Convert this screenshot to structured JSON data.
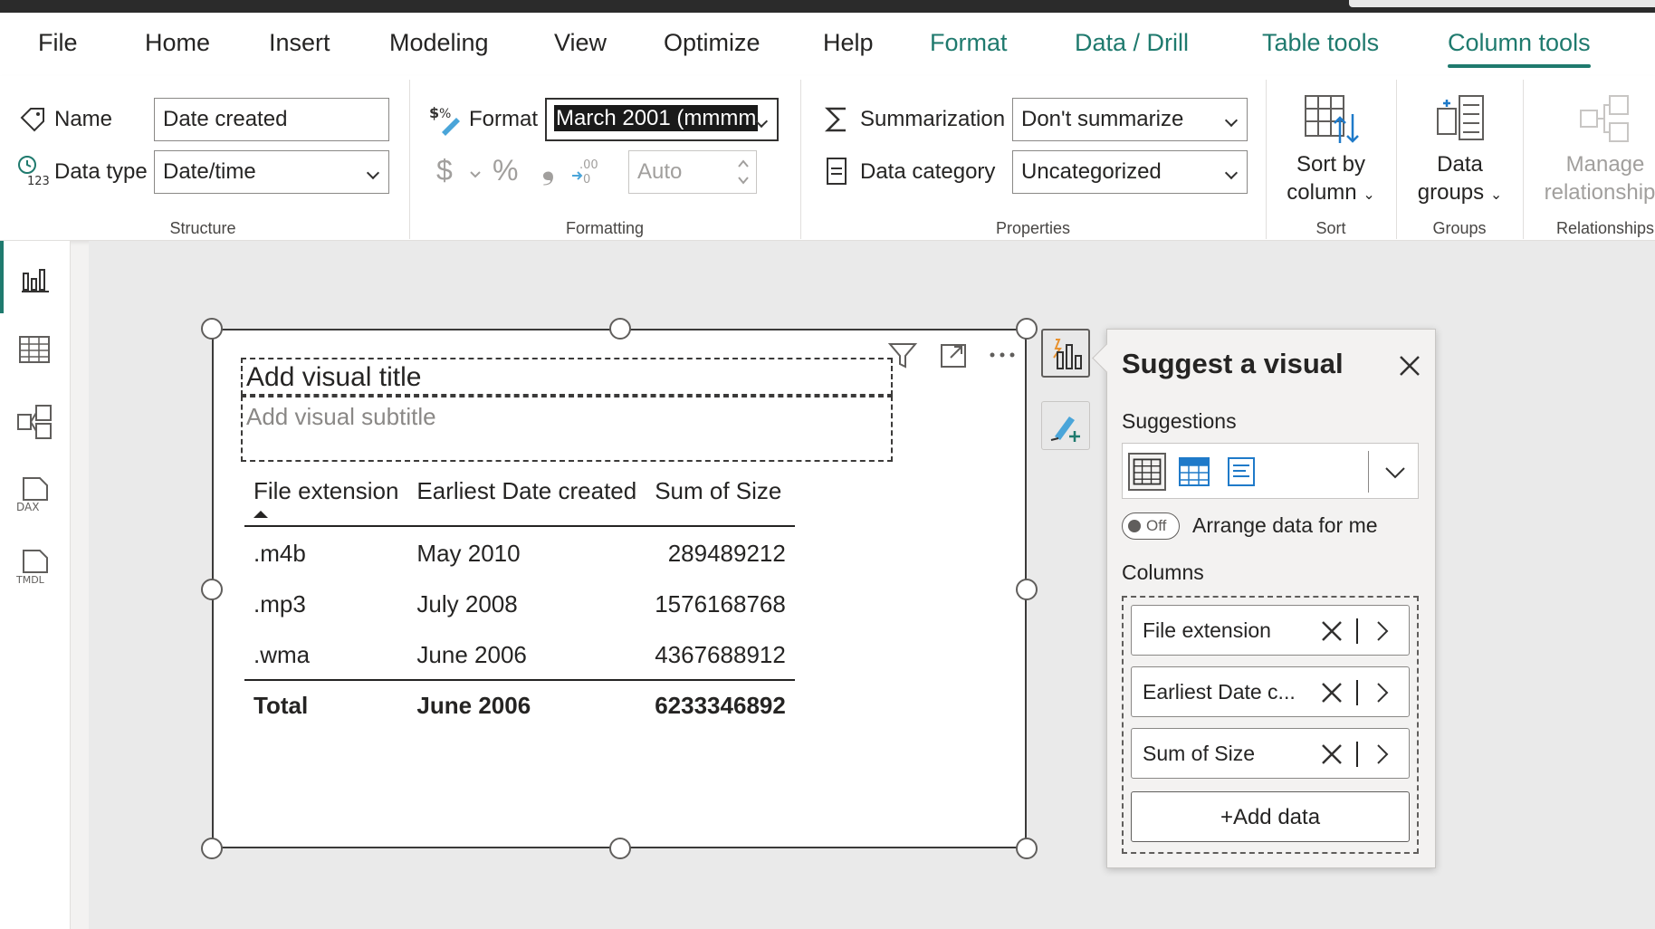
{
  "tabs": [
    "File",
    "Home",
    "Insert",
    "Modeling",
    "View",
    "Optimize",
    "Help",
    "Format",
    "Data / Drill",
    "Table tools",
    "Column tools"
  ],
  "structure": {
    "name_label": "Name",
    "name_value": "Date created",
    "datatype_label": "Data type",
    "datatype_value": "Date/time",
    "group_label": "Structure"
  },
  "formatting": {
    "format_label": "Format",
    "format_value": "March 2001 (mmmm",
    "currency_symbol": "$",
    "percent_symbol": "%",
    "comma_symbol": "❟",
    "decimals_value": "Auto",
    "group_label": "Formatting"
  },
  "properties": {
    "summarization_label": "Summarization",
    "summarization_value": "Don't summarize",
    "category_label": "Data category",
    "category_value": "Uncategorized",
    "group_label": "Properties"
  },
  "sort": {
    "label_line1": "Sort by",
    "label_line2": "column",
    "group_label": "Sort"
  },
  "groups": {
    "label_line1": "Data",
    "label_line2": "groups",
    "group_label": "Groups"
  },
  "relationships": {
    "label_line1": "Manage",
    "label_line2": "relationships",
    "group_label": "Relationships"
  },
  "visual": {
    "title_placeholder": "Add visual title",
    "subtitle_placeholder": "Add visual subtitle",
    "columns": [
      "File extension",
      "Earliest Date created",
      "Sum of Size"
    ],
    "rows": [
      [
        ".m4b",
        "May 2010",
        "289489212"
      ],
      [
        ".mp3",
        "July 2008",
        "1576168768"
      ],
      [
        ".wma",
        "June 2006",
        "4367688912"
      ]
    ],
    "total": [
      "Total",
      "June 2006",
      "6233346892"
    ]
  },
  "panel": {
    "title": "Suggest a visual",
    "suggestions_label": "Suggestions",
    "toggle_state": "Off",
    "toggle_label": "Arrange data for me",
    "columns_label": "Columns",
    "wells": [
      "File extension",
      "Earliest Date c...",
      "Sum of Size"
    ],
    "add_data": "+Add data"
  },
  "colors": {
    "accent": "#1f7a6e",
    "selection": "#1a1a1a"
  }
}
